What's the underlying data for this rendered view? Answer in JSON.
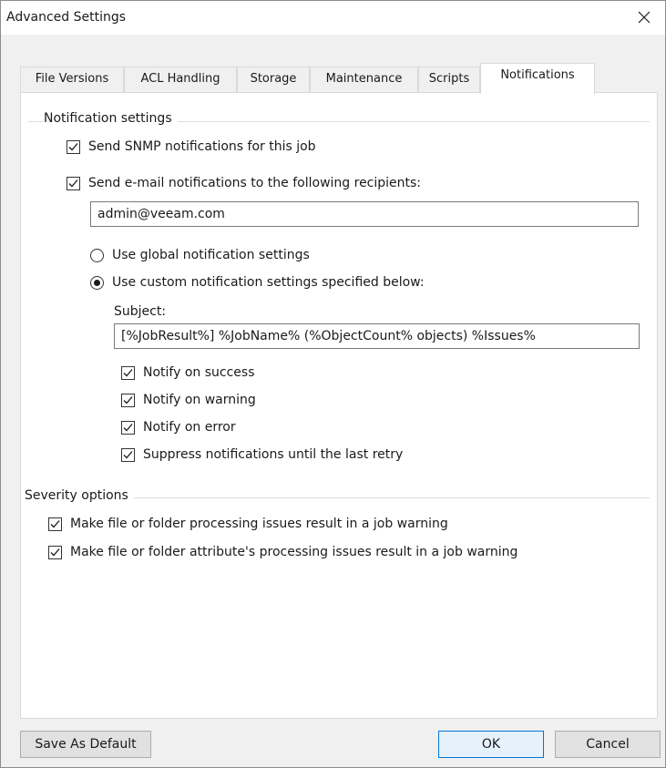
{
  "window": {
    "title": "Advanced Settings"
  },
  "tabs": [
    {
      "label": "File Versions"
    },
    {
      "label": "ACL Handling"
    },
    {
      "label": "Storage"
    },
    {
      "label": "Maintenance"
    },
    {
      "label": "Scripts"
    },
    {
      "label": "Notifications",
      "active": true
    }
  ],
  "notification": {
    "group_title": "Notification settings",
    "snmp_label": "Send SNMP notifications for this job",
    "snmp_checked": true,
    "email_label": "Send e-mail notifications to the following recipients:",
    "email_checked": true,
    "recipients_value": "admin@veeam.com",
    "global_label": "Use global notification settings",
    "global_selected": false,
    "custom_label": "Use custom notification settings specified below:",
    "custom_selected": true,
    "subject_label": "Subject:",
    "subject_value": "[%JobResult%] %JobName% (%ObjectCount% objects) %Issues%",
    "success_label": "Notify on success",
    "warning_label": "Notify on warning",
    "error_label": "Notify on error",
    "suppress_label": "Suppress notifications until the last retry"
  },
  "severity": {
    "group_title": "Severity options",
    "file_folder_label": "Make file or folder processing issues result in a job warning",
    "attribute_label": "Make file or folder attribute's processing issues result in a job warning"
  },
  "buttons": {
    "save_default": "Save As Default",
    "ok": "OK",
    "cancel": "Cancel"
  }
}
